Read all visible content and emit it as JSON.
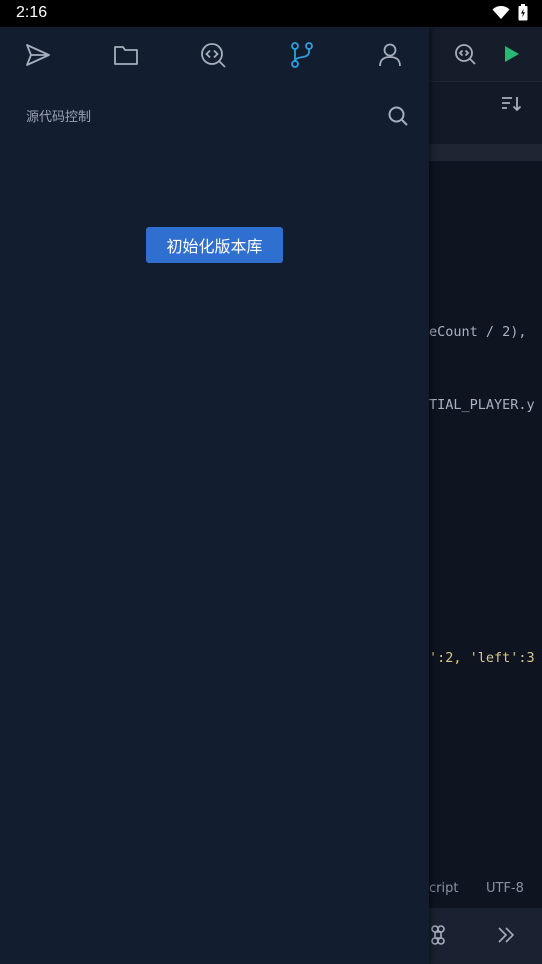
{
  "status_bar": {
    "time": "2:16"
  },
  "drawer": {
    "tabs": [
      {
        "icon": "send-icon",
        "active": false
      },
      {
        "icon": "folder-icon",
        "active": false
      },
      {
        "icon": "code-search-icon",
        "active": false
      },
      {
        "icon": "git-branch-icon",
        "active": true
      },
      {
        "icon": "user-icon",
        "active": false
      }
    ],
    "panel_title": "源代码控制",
    "init_button_label": "初始化版本库"
  },
  "editor": {
    "code_lines": [
      {
        "text": "eCount / 2),"
      },
      {
        "text": "TIAL_PLAYER.y"
      },
      {
        "text": "':2, 'left':3"
      }
    ],
    "footer": {
      "language": "cript",
      "encoding": "UTF-8"
    }
  },
  "colors": {
    "accent_active": "#2d9fe0",
    "icon_inactive": "#a7aebb",
    "button_bg": "#2f6fd0",
    "run_green": "#2bb673"
  }
}
